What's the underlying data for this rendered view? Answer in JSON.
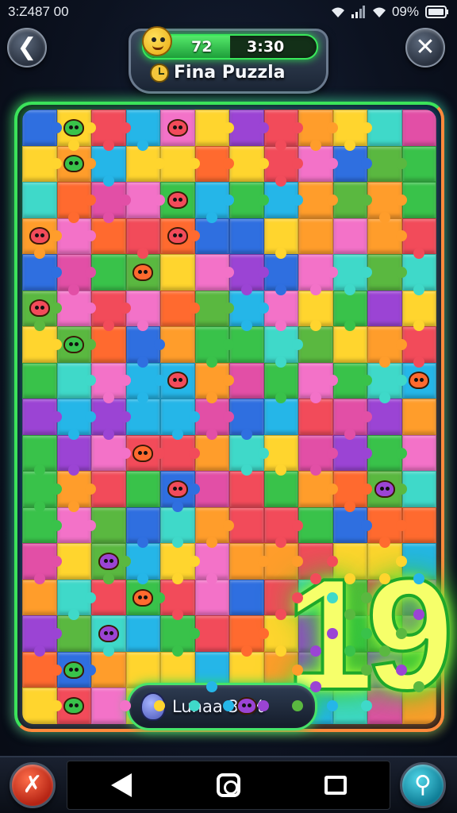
{
  "status_bar": {
    "time": "3:Z487 00",
    "battery_text": "09%",
    "icons": [
      "wifi-icon",
      "signal-icon",
      "wifi-icon",
      "battery-icon"
    ]
  },
  "header": {
    "back_icon": "back-icon",
    "close_icon": "close-icon",
    "score": "72",
    "timer": "3:30",
    "progress": 0.5,
    "title": "Fina Puzzla",
    "title_icon": "clock-icon",
    "mascot_icon": "mascot-icon"
  },
  "board": {
    "rows": 17,
    "columns": 12,
    "palette": [
      "#f24b5a",
      "#ff9d2b",
      "#ffd52e",
      "#39c24a",
      "#25b6e8",
      "#2f6fe0",
      "#9b44d4",
      "#f372c8",
      "#3fd9c9",
      "#ff6a2f",
      "#5ab840",
      "#e24fa6"
    ],
    "level_number": "19"
  },
  "footer": {
    "label": "Lunaa 30%",
    "label_icon": "egg-icon"
  },
  "nav": {
    "left_icon": "tools-icon",
    "right_icon": "search-icon",
    "back_key": "back-key",
    "home_key": "home-key",
    "recents_key": "recents-key"
  }
}
